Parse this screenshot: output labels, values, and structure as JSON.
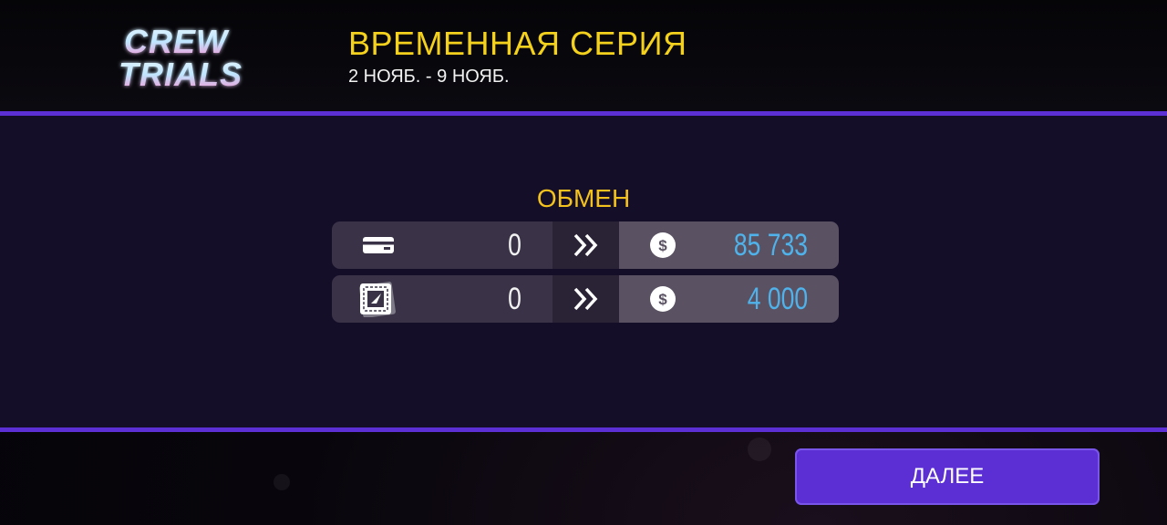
{
  "header": {
    "logo": {
      "line1": "CREW",
      "line2": "TRIALS",
      "color_top": "#e8f6ff",
      "color_bottom": "#f58fd0"
    },
    "title": "ВРЕМЕННАЯ СЕРИЯ",
    "dates": "2 НОЯБ. - 9 НОЯБ."
  },
  "exchange": {
    "title": "ОБМЕН",
    "rows": [
      {
        "item_icon": "card-icon",
        "count": "0",
        "arrow_icon": "double-chevron-right-icon",
        "currency_icon": "dollar-coin-icon",
        "reward": "85 733"
      },
      {
        "item_icon": "badge-token-icon",
        "count": "0",
        "arrow_icon": "double-chevron-right-icon",
        "currency_icon": "dollar-coin-icon",
        "reward": "4 000"
      }
    ]
  },
  "footer": {
    "next_label": "ДАЛЕЕ"
  },
  "colors": {
    "accent_purple": "#5b2fd3",
    "title_yellow": "#f4d11c",
    "reward_blue": "#4fb2ea",
    "panel_bg": "#150e29"
  }
}
